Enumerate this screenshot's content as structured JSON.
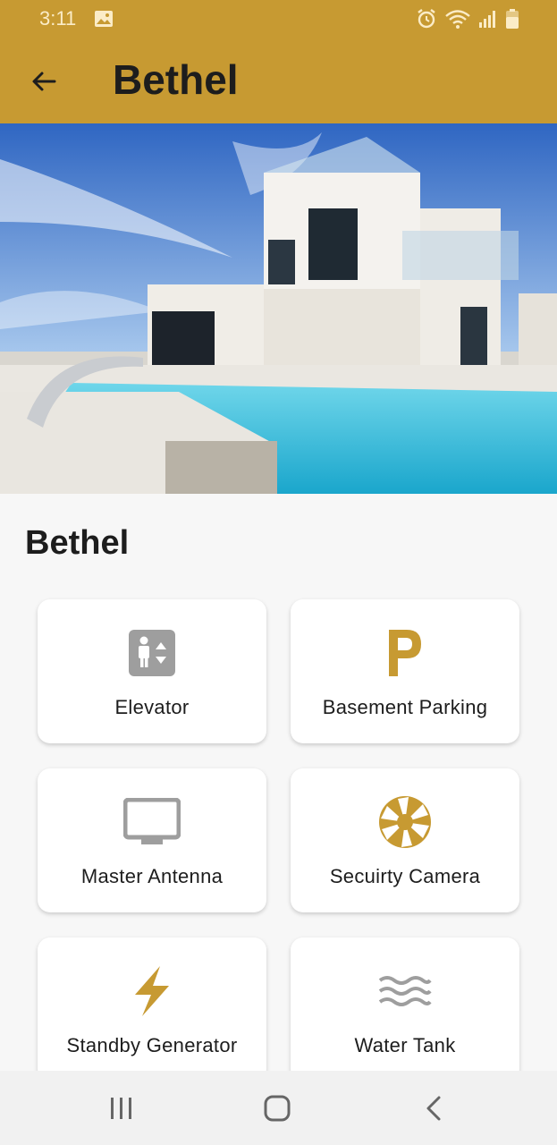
{
  "status_bar": {
    "time": "3:11",
    "icons": [
      "image-icon",
      "alarm-icon",
      "wifi-icon",
      "signal-icon",
      "battery-icon"
    ],
    "background": "#c79a32"
  },
  "app_bar": {
    "title": "Bethel",
    "back_icon": "arrow-left-icon"
  },
  "hero_image": {
    "description_icon": "property-photo"
  },
  "section": {
    "title": "Bethel"
  },
  "amenities": [
    {
      "label": "Elevator",
      "icon": "elevator-icon"
    },
    {
      "label": "Basement Parking",
      "icon": "parking-icon"
    },
    {
      "label": "Master Antenna",
      "icon": "tv-icon"
    },
    {
      "label": "Secuirty Camera",
      "icon": "camera-shutter-icon"
    },
    {
      "label": "Standby Generator",
      "icon": "lightning-icon"
    },
    {
      "label": "Water Tank",
      "icon": "waves-icon"
    }
  ],
  "colors": {
    "accent": "#c79a32",
    "icon_gray": "#9e9e9e",
    "text": "#1d1d1d"
  },
  "nav_bar": {
    "buttons": [
      "recents-icon",
      "home-icon",
      "back-icon"
    ]
  }
}
